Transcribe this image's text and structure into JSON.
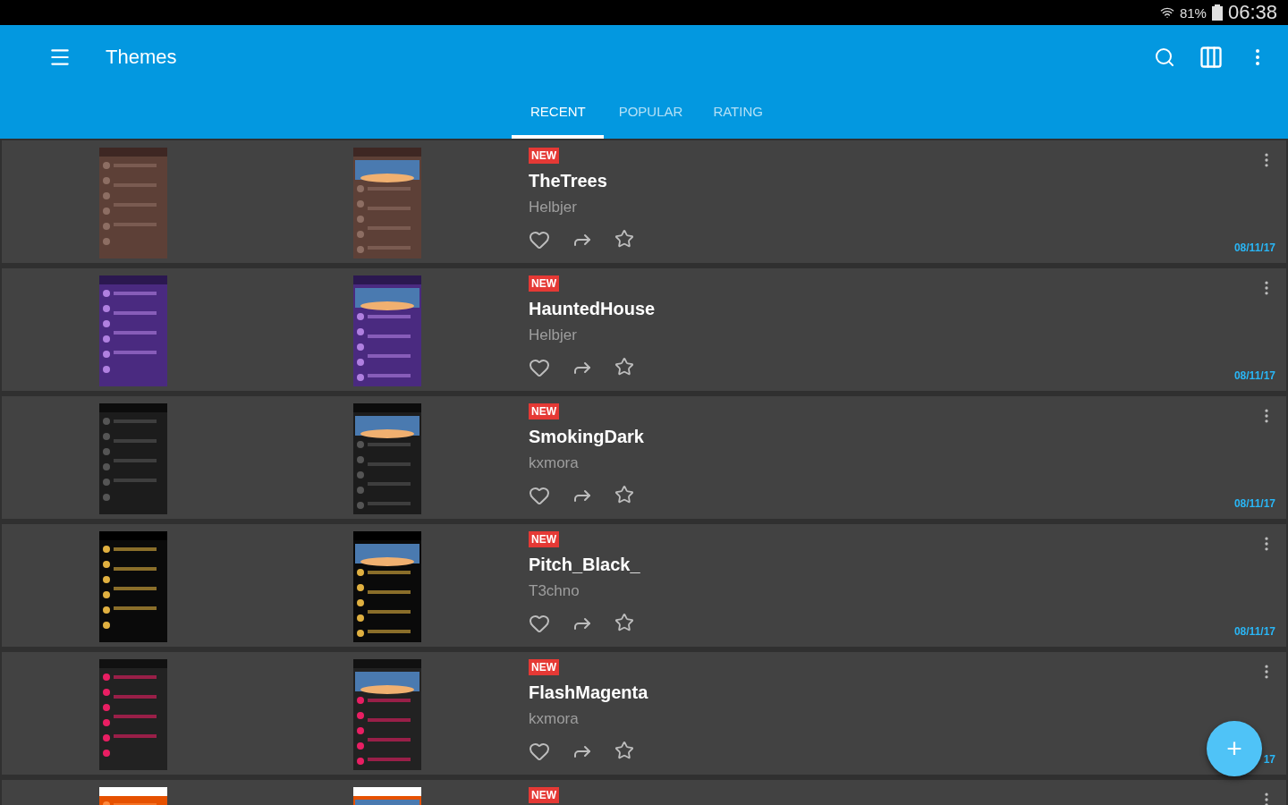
{
  "status_bar": {
    "battery": "81%",
    "time": "06:38"
  },
  "app_bar": {
    "title": "Themes"
  },
  "tabs": [
    {
      "label": "RECENT",
      "selected": true
    },
    {
      "label": "POPULAR",
      "selected": false
    },
    {
      "label": "RATING",
      "selected": false
    }
  ],
  "themes": [
    {
      "badge": "NEW",
      "title": "TheTrees",
      "author": "Helbjer",
      "date": "08/11/17"
    },
    {
      "badge": "NEW",
      "title": "HauntedHouse",
      "author": "Helbjer",
      "date": "08/11/17"
    },
    {
      "badge": "NEW",
      "title": "SmokingDark",
      "author": "kxmora",
      "date": "08/11/17"
    },
    {
      "badge": "NEW",
      "title": "Pitch_Black_",
      "author": "T3chno",
      "date": "08/11/17"
    },
    {
      "badge": "NEW",
      "title": "FlashMagenta",
      "author": "kxmora",
      "date": "17"
    },
    {
      "badge": "NEW"
    }
  ],
  "fab": {
    "label": "+"
  }
}
